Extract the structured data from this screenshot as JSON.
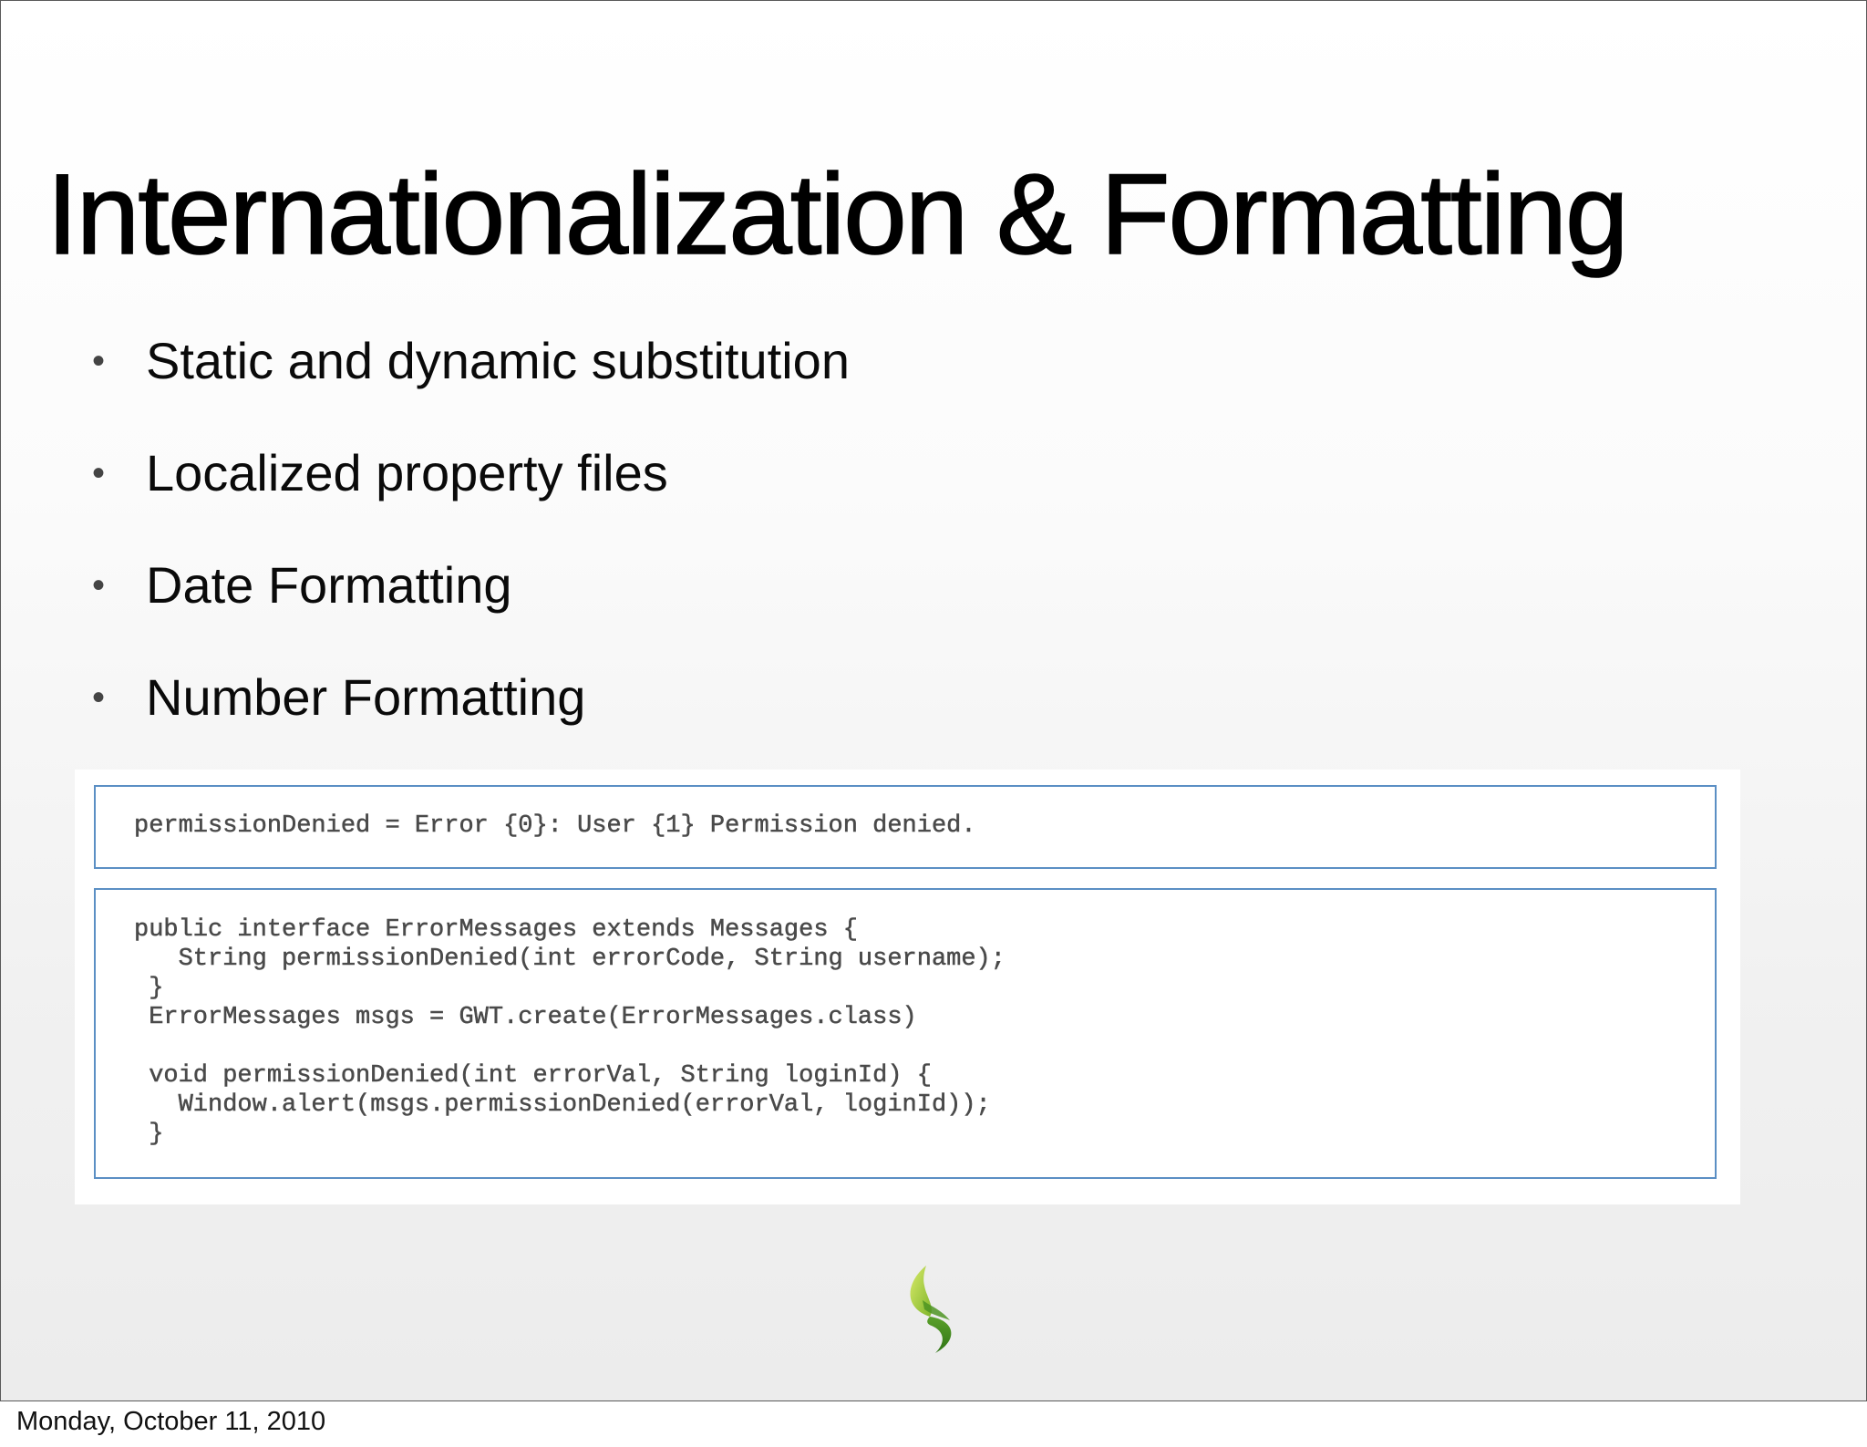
{
  "slide": {
    "title": "Internationalization & Formatting",
    "bullets": [
      "Static and dynamic substitution",
      "Localized property files",
      "Date Formatting",
      "Number Formatting"
    ],
    "bullet_glyph": "•",
    "code_properties": [
      "permissionDenied = Error {0}: User {1} Permission denied."
    ],
    "code_java": [
      "public interface ErrorMessages extends Messages {",
      "   String permissionDenied(int errorCode, String username);",
      " }",
      " ErrorMessages msgs = GWT.create(ErrorMessages.class)",
      "",
      " void permissionDenied(int errorVal, String loginId) {",
      "   Window.alert(msgs.permissionDenied(errorVal, loginId));",
      " }"
    ],
    "logo_icon": "green-leaf-s-logo-icon",
    "colors": {
      "code_border": "#5b8fc4",
      "code_text": "#4a4a4a",
      "logo_light": "#b9d64a",
      "logo_dark": "#3f8c1e"
    }
  },
  "footer": {
    "date": "Monday, October 11, 2010"
  }
}
